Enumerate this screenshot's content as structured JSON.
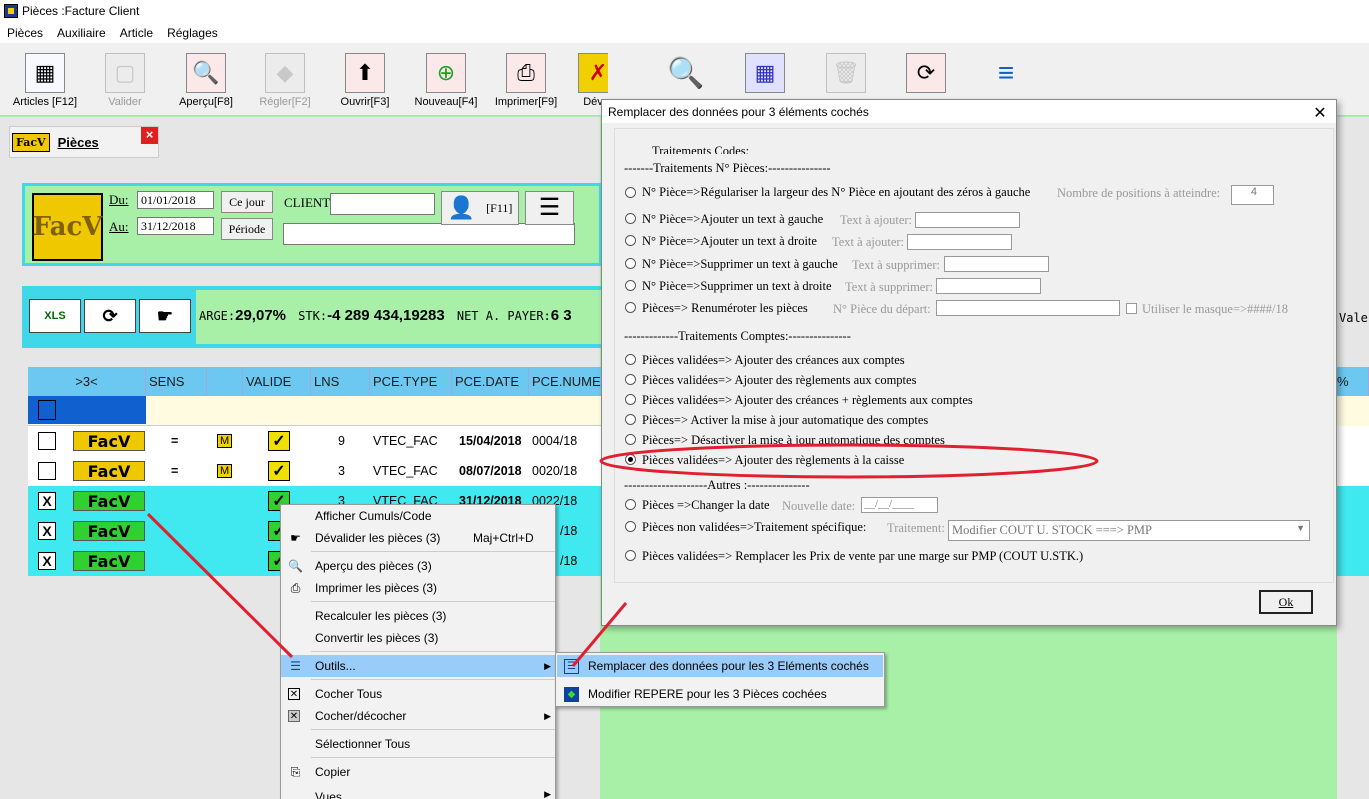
{
  "window": {
    "title": "Pièces :Facture Client"
  },
  "menu": [
    "Pièces",
    "Auxiliaire",
    "Article",
    "Réglages"
  ],
  "toolbar": {
    "articles": "Articles [F12]",
    "valider": "Valider",
    "apercu": "Aperçu[F8]",
    "regler": "Régler[F2]",
    "ouvrir": "Ouvrir[F3]",
    "nouveau": "Nouveau[F4]",
    "imprimer": "Imprimer[F9]",
    "dev": "Dév"
  },
  "tab": {
    "badge": "FacV",
    "label": "Pièces",
    "close": "×"
  },
  "filter": {
    "du_label": "Du:",
    "du_value": "01/01/2018",
    "au_label": "Au:",
    "au_value": "31/12/2018",
    "ce_jour": "Ce jour",
    "periode": "Période",
    "client_label": "CLIENT:",
    "f11": "[F11]",
    "logo": "FacV"
  },
  "totals": {
    "marge_label": "ARGE:",
    "marge_value": "29,07%",
    "stk_label": "STK:",
    "stk_value": "-4 289 434,19283",
    "net_label": "NET A. PAYER:",
    "net_value": "6 3",
    "xls": "XLS",
    "vale": "Vale"
  },
  "grid": {
    "headers": [
      ">3<",
      "SENS",
      "",
      "VALIDE",
      "LNS",
      "PCE.TYPE",
      "PCE.DATE",
      "PCE.NUME"
    ],
    "rows": [
      {
        "checked": "",
        "badge": "FacV",
        "sens": "=",
        "m": "M",
        "valid": "✓",
        "lns": "9",
        "type": "VTEC_FAC",
        "date": "15/04/2018",
        "num": "0004/18"
      },
      {
        "checked": "",
        "badge": "FacV",
        "sens": "=",
        "m": "M",
        "valid": "✓",
        "lns": "3",
        "type": "VTEC_FAC",
        "date": "08/07/2018",
        "num": "0020/18"
      },
      {
        "checked": "X",
        "badge": "FacV",
        "sens": "",
        "m": "",
        "valid": "✓",
        "lns": "3",
        "type": "VTEC_FAC",
        "date": "31/12/2018",
        "num": "0022/18"
      },
      {
        "checked": "X",
        "badge": "FacV",
        "sens": "",
        "m": "",
        "valid": "✓",
        "lns": "",
        "type": "",
        "date": "",
        "num": "/18"
      },
      {
        "checked": "X",
        "badge": "FacV",
        "sens": "",
        "m": "",
        "valid": "✓",
        "lns": "",
        "type": "",
        "date": "",
        "num": "/18"
      }
    ],
    "right_header": "%"
  },
  "context_menu": {
    "afficher": "Afficher Cumuls/Code",
    "devalider": "Dévalider les pièces (3)",
    "devalider_sc": "Maj+Ctrl+D",
    "apercu": "Aperçu des pièces  (3)",
    "imprimer": "Imprimer les pièces (3)",
    "recalculer": "Recalculer les pièces  (3)",
    "convertir": "Convertir les pièces  (3)",
    "outils": "Outils...",
    "cocher_tous": "Cocher Tous",
    "cocher_decocher": "Cocher/décocher",
    "selectionner": "Sélectionner Tous",
    "copier": "Copier",
    "vues": "Vues"
  },
  "sub_menu": {
    "remplacer": "Remplacer des données pour les 3 Eléments cochés",
    "modifier": "Modifier REPERE pour les 3 Pièces cochées"
  },
  "dialog": {
    "title": "Remplacer des données pour 3 éléments cochés",
    "hidden_header": "Traitements Codes:",
    "sec_pieces": "-------Traitements N° Pièces:---------------",
    "opt1": "N° Pièce=>Régulariser la largeur des N° Pièce en ajoutant des zéros à gauche",
    "opt1_hint": "Nombre de positions à atteindre:",
    "opt1_val": "4",
    "opt2": "N° Pièce=>Ajouter un text à gauche",
    "opt2_hint": "Text à ajouter:",
    "opt3": "N° Pièce=>Ajouter un text à droite",
    "opt3_hint": "Text à ajouter:",
    "opt4": "N° Pièce=>Supprimer un text à gauche",
    "opt4_hint": "Text à supprimer:",
    "opt5": "N° Pièce=>Supprimer un text à droite",
    "opt5_hint": "Text à supprimer:",
    "opt6": "Pièces=> Renuméroter les pièces",
    "opt6_hint": "N° Pièce du départ:",
    "opt6_mask": "Utiliser le masque=>####/18",
    "sec_comptes": "-------------Traitements Comptes:---------------",
    "opt7": "Pièces validées=> Ajouter des créances aux comptes",
    "opt8": "Pièces validées=> Ajouter des règlements aux comptes",
    "opt9": "Pièces validées=> Ajouter des créances + règlements  aux comptes",
    "opt10": "Pièces=> Activer la mise à jour automatique des comptes",
    "opt11": "Pièces=> Désactiver la mise à jour automatique des comptes",
    "opt12": "Pièces validées=> Ajouter des règlements à la caisse",
    "sec_autres": "--------------------Autres :---------------",
    "opt13": "Pièces =>Changer la date",
    "opt13_hint": "Nouvelle date:",
    "opt13_val": "__/__/____",
    "opt14": "Pièces non validées=>Traitement spécifique:",
    "opt14_hint": "Traitement:",
    "opt14_val": "Modifier COUT U. STOCK ===> PMP",
    "opt15": "Pièces validées=> Remplacer les Prix de vente par une marge sur PMP (COUT U.STK.)",
    "ok": "Ok"
  },
  "colors": {
    "cyan": "#40d8e8",
    "green": "#a8f0a8",
    "header": "#6cc8f0",
    "selected_row": "#40e8f0",
    "facv_yellow": "#f0c800",
    "facv_green": "#30d030",
    "annotation": "#e02030"
  }
}
